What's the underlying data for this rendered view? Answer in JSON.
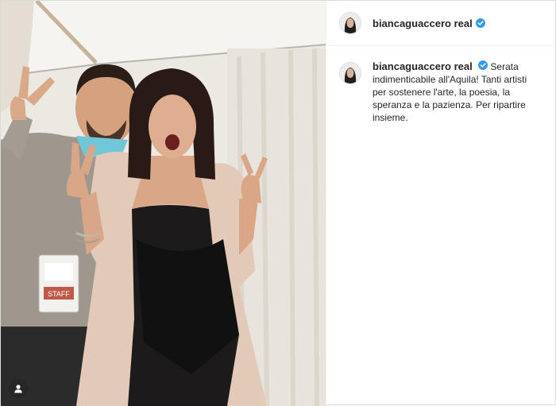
{
  "post": {
    "username": "biancaguaccero real",
    "verified": true,
    "caption": "Serata indimenticabile all'Aquila! Tanti artisti per sostenere l'arte, la poesia, la speranza e la pazienza. Per ripartire insieme.",
    "badge_text": "STAFF"
  },
  "colors": {
    "verified_blue": "#3897f0",
    "text": "#262626",
    "border": "#dbdbdb"
  },
  "icons": {
    "verified": "verified-badge-icon",
    "user_tag": "user-tag-icon"
  }
}
